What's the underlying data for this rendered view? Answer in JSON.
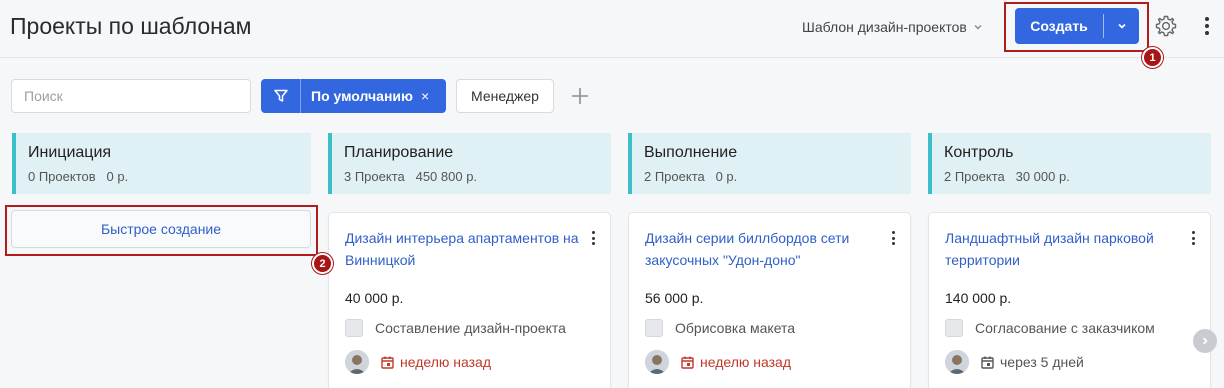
{
  "header": {
    "title": "Проекты по шаблонам",
    "template_selector": "Шаблон дизайн-проектов",
    "create_label": "Создать"
  },
  "toolbar": {
    "search_placeholder": "Поиск",
    "filter_label": "По умолчанию",
    "filter_close": "×",
    "manager_label": "Менеджер"
  },
  "colors": {
    "accent": "#3367e0",
    "column_header_bg": "#dff1f4",
    "column_header_border": "#3dbfc9",
    "link": "#2f5fc8",
    "overdue": "#c0392b",
    "highlight": "#b11c1c"
  },
  "columns": [
    {
      "name": "Инициация",
      "count": "0 Проектов",
      "sum": "0 р."
    },
    {
      "name": "Планирование",
      "count": "3 Проекта",
      "sum": "450 800 р."
    },
    {
      "name": "Выполнение",
      "count": "2 Проекта",
      "sum": "0 р."
    },
    {
      "name": "Контроль",
      "count": "2 Проекта",
      "sum": "30 000 р."
    }
  ],
  "quick_create_label": "Быстрое создание",
  "cards": [
    {
      "title": "Дизайн интерьера апартаментов на Винницкой",
      "amount": "40 000 р.",
      "task": "Составление дизайн-проекта",
      "due": "неделю назад",
      "due_state": "overdue"
    },
    {
      "title": "Дизайн серии биллбордов сети закусочных \"Удон-доно\"",
      "amount": "56 000 р.",
      "task": "Обрисовка макета",
      "due": "неделю назад",
      "due_state": "overdue"
    },
    {
      "title": "Ландшафтный дизайн парковой территории",
      "amount": "140 000 р.",
      "task": "Согласование с заказчиком",
      "due": "через 5 дней",
      "due_state": "normal"
    }
  ],
  "markers": [
    "1",
    "2"
  ],
  "icons": [
    "chevron-down-icon",
    "gear-icon",
    "more-vertical-icon",
    "filter-icon",
    "plus-icon",
    "calendar-icon",
    "chevron-right-icon"
  ]
}
